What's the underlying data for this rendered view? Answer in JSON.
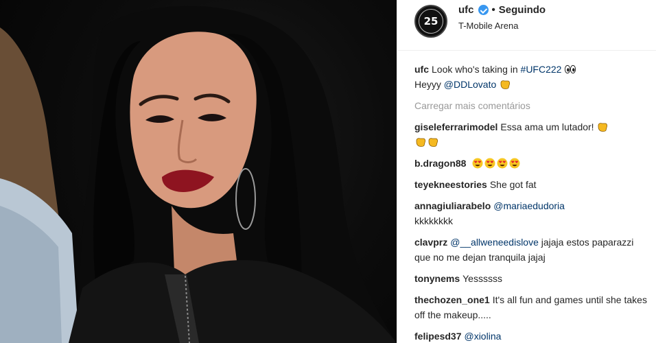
{
  "post": {
    "photo_alt": "photo",
    "username": "ufc",
    "separator": "•",
    "follow_status": "Seguindo",
    "location": "T-Mobile Arena",
    "avatar_text": "25"
  },
  "caption": {
    "user": "ufc",
    "text_before": "Look who's taking in ",
    "hashtag": "#UFC222",
    "line2_before": "Heyyy ",
    "mention": "@DDLovato"
  },
  "load_more_label": "Carregar mais comentários",
  "comments": [
    {
      "user": "giseleferrarimodel",
      "text": "Essa ama um lutador!"
    },
    {
      "user": "b.dragon88",
      "text": ""
    },
    {
      "user": "teyekneestories",
      "text": "She got fat"
    },
    {
      "user": "annagiuliarabelo",
      "mention": "@mariaedudoria",
      "text": "kkkkkkkk"
    },
    {
      "user": "clavprz",
      "mention": "@__allweneedislove",
      "text": " jajaja estos paparazzi que no me dejan tranquila jajaj"
    },
    {
      "user": "tonynems",
      "text": "Yessssss"
    },
    {
      "user": "thechozen_one1",
      "text": "It's all fun and games until she takes off the makeup....."
    },
    {
      "user": "felipesd37",
      "mention": "@xiolina"
    }
  ],
  "icons": {
    "eyes": "eyes-emoji",
    "fist": "fist-emoji",
    "heart_eyes": "heart-eyes-emoji"
  },
  "colors": {
    "link": "#003569",
    "verified": "#3897f0",
    "muted": "#999999"
  }
}
